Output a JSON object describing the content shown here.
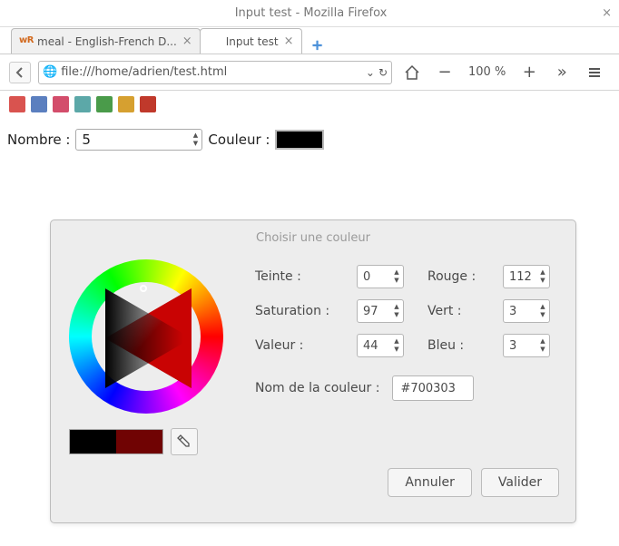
{
  "window": {
    "title": "Input test - Mozilla Firefox"
  },
  "tabs": [
    {
      "label": "meal - English-French D...",
      "favicon": "wR"
    },
    {
      "label": "Input test",
      "favicon": ""
    }
  ],
  "url": "file:///home/adrien/test.html",
  "zoom": "100 %",
  "bookmarks": [
    {
      "color": "#d9534f"
    },
    {
      "color": "#5b7fbf"
    },
    {
      "color": "#d34d6b"
    },
    {
      "color": "#5ca8a8"
    },
    {
      "color": "#4a9b4a"
    },
    {
      "color": "#d6a030"
    },
    {
      "color": "#c0392b"
    }
  ],
  "form": {
    "nombre_label": "Nombre :",
    "nombre_value": "5",
    "couleur_label": "Couleur :",
    "couleur_value": "#000000"
  },
  "picker": {
    "title": "Choisir une couleur",
    "teinte_label": "Teinte :",
    "teinte_value": "0",
    "saturation_label": "Saturation :",
    "saturation_value": "97",
    "valeur_label": "Valeur :",
    "valeur_value": "44",
    "rouge_label": "Rouge :",
    "rouge_value": "112",
    "vert_label": "Vert :",
    "vert_value": "3",
    "bleu_label": "Bleu :",
    "bleu_value": "3",
    "name_label": "Nom de la couleur :",
    "name_value": "#700303",
    "swatch_old": "#000000",
    "swatch_new": "#700303",
    "cancel": "Annuler",
    "ok": "Valider"
  }
}
